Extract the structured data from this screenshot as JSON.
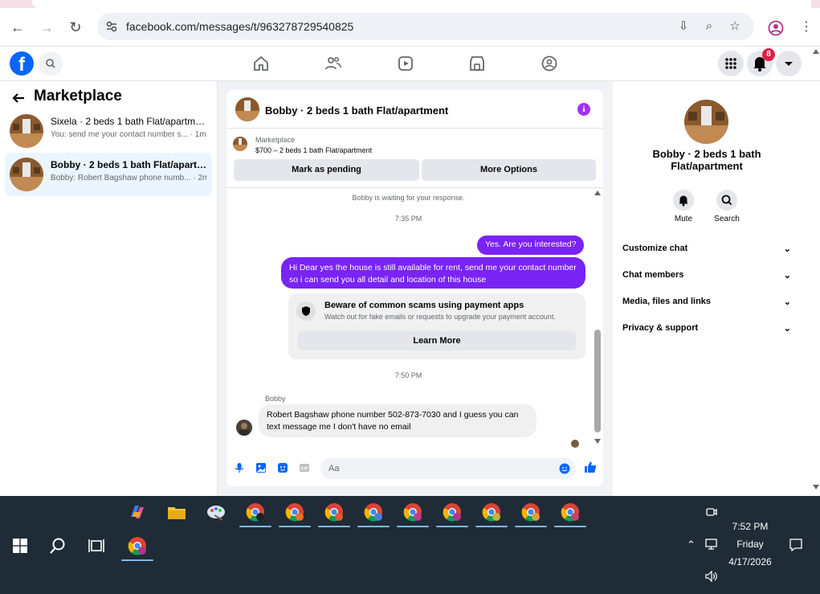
{
  "browser": {
    "url": "facebook.com/messages/t/963278729540825"
  },
  "facebook": {
    "notification_count": "8"
  },
  "left_pane": {
    "title": "Marketplace",
    "conversations": [
      {
        "name": "Sixela · 2 beds 1 bath Flat/apartment",
        "preview": "You: send me your contact number s...",
        "time": "· 1m"
      },
      {
        "name": "Bobby · 2 beds 1 bath Flat/apartm...",
        "preview": "Bobby: Robert Bagshaw phone numb...",
        "time": "· 2m"
      }
    ]
  },
  "chat": {
    "title": "Bobby · 2 beds 1 bath Flat/apartment",
    "marketplace_label": "Marketplace",
    "listing": "$700 – 2 beds 1 bath Flat/apartment",
    "mark_pending": "Mark as pending",
    "more_options": "More Options",
    "waiting": "Bobby is waiting for your response.",
    "time1": "7:35 PM",
    "out_msg1": "Yes. Are you interested?",
    "out_msg2": "Hi Dear yes the house is still available for rent, send me your contact number so i can send you all detail and location of this house",
    "scam_title": "Beware of common scams using payment apps",
    "scam_sub": "Watch out for fake emails or requests to upgrade your payment account.",
    "learn_more": "Learn More",
    "time2": "7:50 PM",
    "sender": "Bobby",
    "in_msg": "Robert Bagshaw phone number 502-873-7030 and I guess you can text message me I don't have no email",
    "placeholder": "Aa"
  },
  "right_pane": {
    "name": "Bobby · 2 beds 1 bath Flat/apartment",
    "mute": "Mute",
    "search": "Search",
    "rows": [
      "Customize chat",
      "Chat members",
      "Media, files and links",
      "Privacy & support"
    ]
  },
  "taskbar": {
    "time": "7:52 PM",
    "day": "Friday",
    "date": "4/17/2026"
  },
  "colors": {
    "accent": "#7a23f5",
    "fb_blue": "#0866ff",
    "taskbar": "#1f2b36"
  }
}
